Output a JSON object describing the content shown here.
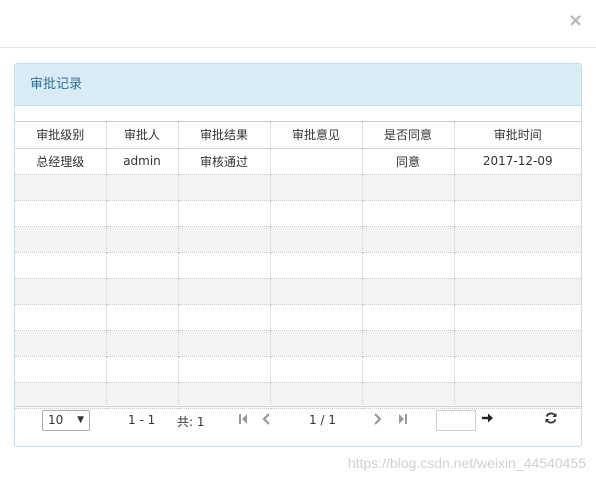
{
  "modal": {
    "close_glyph": "×"
  },
  "panel": {
    "title": "审批记录"
  },
  "table": {
    "columns": [
      "审批级别",
      "审批人",
      "审批结果",
      "审批意见",
      "是否同意",
      "审批时间"
    ],
    "rows": [
      [
        "总经理级",
        "admin",
        "审核通过",
        "",
        "同意",
        "2017-12-09"
      ]
    ],
    "empty_rows": 9
  },
  "pager": {
    "page_size": "10",
    "range": "1 - 1",
    "total": "共: 1",
    "page_indicator": "1 / 1",
    "goto_value": ""
  },
  "icons": {
    "close": "close-icon",
    "first": "first-page-icon",
    "prev": "prev-page-icon",
    "next": "next-page-icon",
    "last": "last-page-icon",
    "goto": "arrow-right-icon",
    "refresh": "refresh-icon",
    "dropdown": "chevron-down-icon"
  },
  "watermark": "https://blog.csdn.net/weixin_44540455"
}
